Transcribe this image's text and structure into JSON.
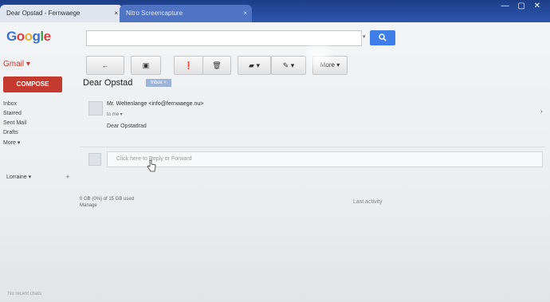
{
  "browser": {
    "active_tab": "Dear Opstad - Fernwaege",
    "inactive_tab": "Nitro Screencapture",
    "tab_close": "×",
    "window_controls": "— ▢ ✕"
  },
  "header": {
    "logo": [
      "G",
      "o",
      "o",
      "g",
      "l",
      "e"
    ],
    "search_value": "",
    "search_dropdown": "▾"
  },
  "sidebar": {
    "title": "Gmail ▾",
    "compose": "COMPOSE",
    "items": [
      "Inbox",
      "Starred",
      "Sent Mail",
      "Drafts",
      "More ▾"
    ],
    "hangouts_user": "Lorraine ▾",
    "hangouts_add": "+",
    "footer": "No recent chats"
  },
  "toolbar": {
    "back": "←",
    "archive": "▣",
    "spam": "❗",
    "delete": "🗑",
    "move": "▰ ▾",
    "labels": "✎ ▾",
    "more": "More ▾"
  },
  "thread": {
    "subject": "Dear Opstad",
    "label_badge": "Inbox ×",
    "sender": "Mr. Weltenlange <info@fernwaege.nu>",
    "to": "to me ▾",
    "body": "Dear Opstadrad",
    "expand": "›",
    "reply_placeholder": "Click here to Reply or Forward"
  },
  "footer": {
    "storage_line1": "0 GB (0%) of 15 GB used",
    "storage_line2": "Manage",
    "activity": "Last activity"
  }
}
